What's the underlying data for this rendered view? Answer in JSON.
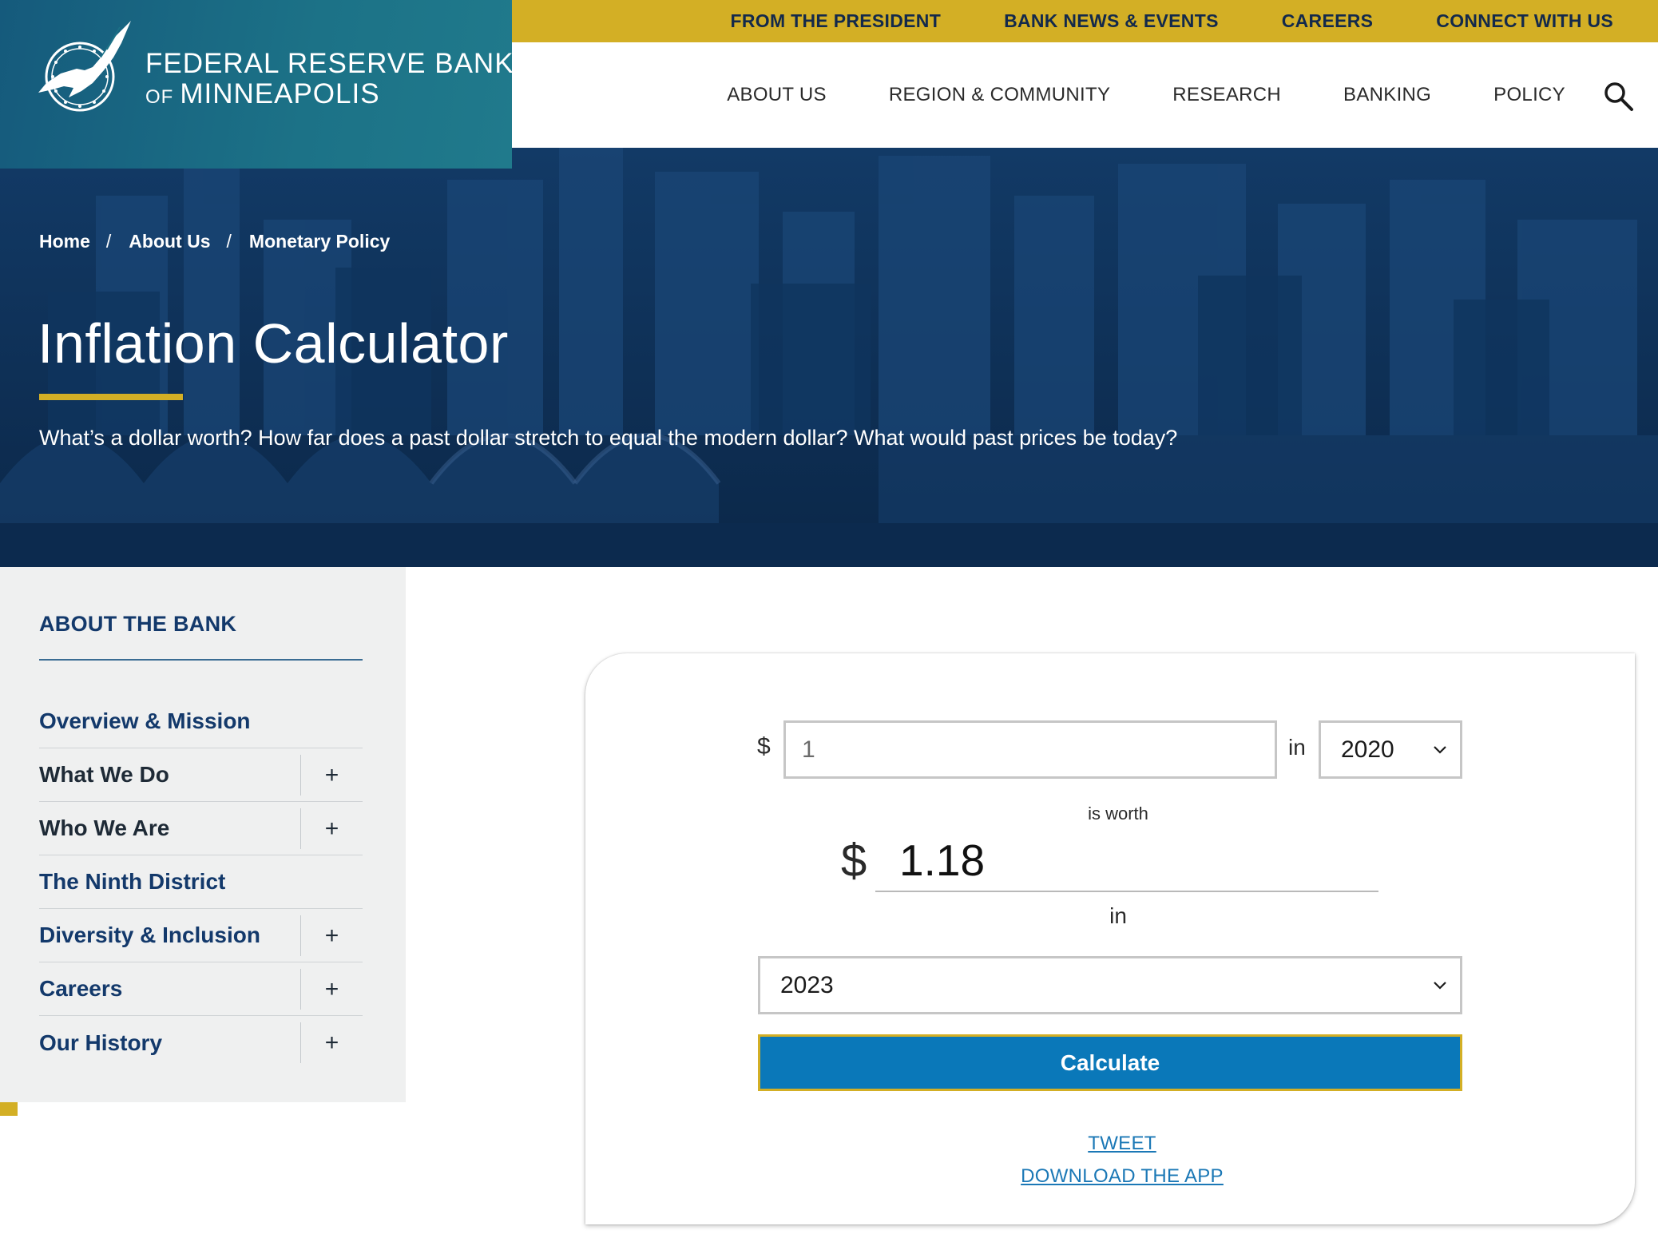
{
  "brand": {
    "line1": "FEDERAL RESERVE BANK",
    "of": "OF",
    "line2": "MINNEAPOLIS"
  },
  "utility_nav": [
    {
      "label": "FROM THE PRESIDENT"
    },
    {
      "label": "BANK NEWS & EVENTS"
    },
    {
      "label": "CAREERS"
    },
    {
      "label": "CONNECT WITH US"
    }
  ],
  "main_nav": [
    {
      "label": "ABOUT US"
    },
    {
      "label": "REGION & COMMUNITY"
    },
    {
      "label": "RESEARCH"
    },
    {
      "label": "BANKING"
    },
    {
      "label": "POLICY"
    }
  ],
  "breadcrumb": [
    {
      "label": "Home"
    },
    {
      "label": "About Us"
    },
    {
      "label": "Monetary Policy"
    }
  ],
  "breadcrumb_separator": "/",
  "hero": {
    "title": "Inflation Calculator",
    "subtitle": "What’s a dollar worth? How far does a past dollar stretch to equal the modern dollar? What would past prices be today?"
  },
  "sidebar": {
    "heading": "ABOUT THE BANK",
    "items": [
      {
        "label": "Overview & Mission",
        "expandable": false,
        "style": "blue"
      },
      {
        "label": "What We Do",
        "expandable": true,
        "style": "dark"
      },
      {
        "label": "Who We Are",
        "expandable": true,
        "style": "dark"
      },
      {
        "label": "The Ninth District",
        "expandable": false,
        "style": "blue"
      },
      {
        "label": "Diversity & Inclusion",
        "expandable": true,
        "style": "blue"
      },
      {
        "label": "Careers",
        "expandable": true,
        "style": "blue"
      },
      {
        "label": "Our History",
        "expandable": true,
        "style": "blue"
      }
    ],
    "expand_symbol": "+"
  },
  "calculator": {
    "currency_symbol": "$",
    "amount_value": "1",
    "in_label": "in",
    "from_year": "2020",
    "is_worth_label": "is worth",
    "result_currency": "$",
    "result_value": "1.18",
    "in_label_2": "in",
    "to_year": "2023",
    "calculate_label": "Calculate",
    "tweet_label": "TWEET",
    "download_label": "DOWNLOAD THE APP"
  },
  "colors": {
    "teal": "#1c7287",
    "gold": "#d3af25",
    "navy": "#13396b",
    "button_blue": "#0a78b9",
    "link_blue": "#1b78b6"
  }
}
